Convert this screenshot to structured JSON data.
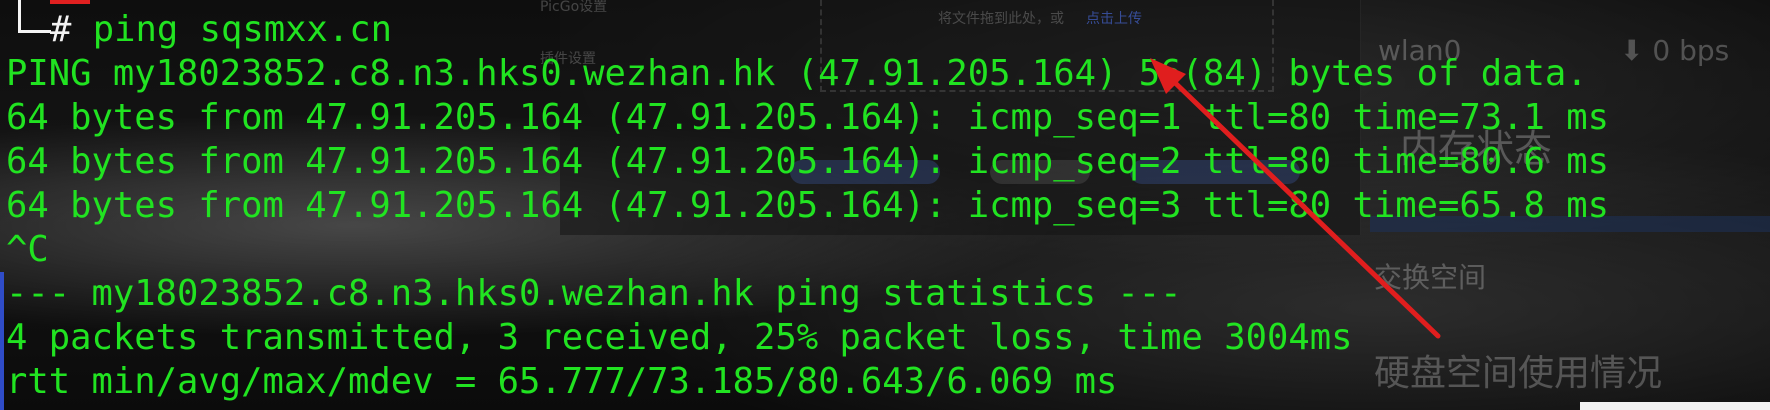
{
  "terminal": {
    "command_line": {
      "prompt_symbol": "#",
      "command": " ping sqsmxx.cn"
    },
    "lines": [
      "PING my18023852.c8.n3.hks0.wezhan.hk (47.91.205.164) 56(84) bytes of data.",
      "64 bytes from 47.91.205.164 (47.91.205.164): icmp_seq=1 ttl=80 time=73.1 ms",
      "64 bytes from 47.91.205.164 (47.91.205.164): icmp_seq=2 ttl=80 time=80.6 ms",
      "64 bytes from 47.91.205.164 (47.91.205.164): icmp_seq=3 ttl=80 time=65.8 ms",
      "^C",
      "--- my18023852.c8.n3.hks0.wezhan.hk ping statistics ---",
      "4 packets transmitted, 3 received, 25% packet loss, time 3004ms",
      "rtt min/avg/max/mdev = 65.777/73.185/80.643/6.069 ms"
    ]
  },
  "background_ui": {
    "picgo_settings": "PicGo设置",
    "plugin_settings": "插件设置",
    "dropzone_text": "将文件拖到此处，或",
    "dropzone_link": "点击上传",
    "interface_name": "wlan0",
    "bandwidth": "⬇ 0 bps",
    "memory_status": "内存状态",
    "swap_space": "交换空间",
    "disk_usage": "硬盘空间使用情况"
  },
  "colors": {
    "terminal_green": "#21e321",
    "arrow_red": "#e01e1e"
  }
}
